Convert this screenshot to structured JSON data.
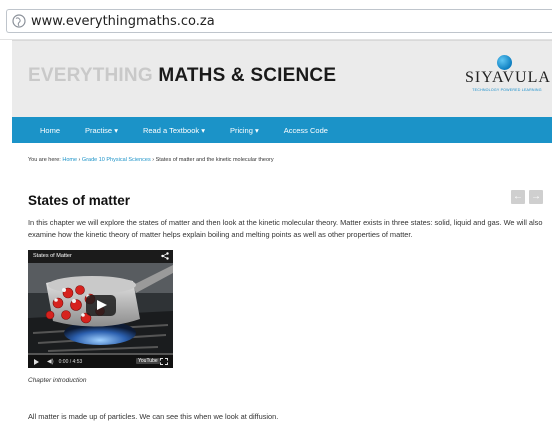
{
  "browser": {
    "url": "www.everythingmaths.co.za"
  },
  "header": {
    "brand_light": "EVERYTHING",
    "brand_dark": "MATHS & SCIENCE",
    "logo_word": "SIYAVULA",
    "logo_tagline": "TECHNOLOGY POWERED LEARNING"
  },
  "nav": {
    "items": [
      {
        "label": "Home"
      },
      {
        "label": "Practise ▾"
      },
      {
        "label": "Read a Textbook ▾"
      },
      {
        "label": "Pricing ▾"
      },
      {
        "label": "Access Code"
      }
    ]
  },
  "breadcrumb": {
    "prefix": "You are here: ",
    "home": "Home",
    "sep": " › ",
    "section": "Grade 10 Physical Sciences",
    "current": "States of matter and the kinetic molecular theory"
  },
  "page": {
    "title": "States of matter",
    "prev_arrow": "←",
    "next_arrow": "→",
    "intro": "In this chapter we will explore the states of matter and then look at the kinetic molecular theory. Matter exists in three states: solid, liquid and gas. We will also examine how the kinetic theory of matter helps explain boiling and melting points as well as other properties of matter.",
    "caption": "Chapter introduction",
    "paragraph": "All matter is made up of particles. We can see this when we look at diffusion."
  },
  "video": {
    "title": "States of Matter",
    "time": "0:00 / 4:53",
    "youtube_label": "YouTube",
    "progress": 0
  },
  "colors": {
    "nav_bg": "#1b93c8",
    "header_bg": "#ebebeb",
    "link": "#1b93c8"
  }
}
